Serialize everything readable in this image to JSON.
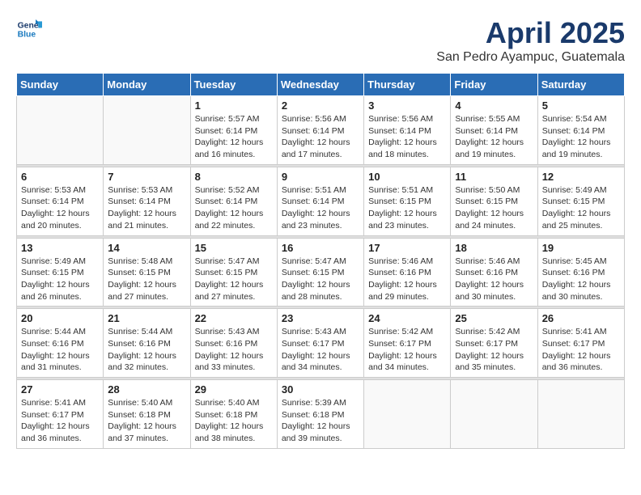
{
  "header": {
    "logo_line1": "General",
    "logo_line2": "Blue",
    "month": "April 2025",
    "location": "San Pedro Ayampuc, Guatemala"
  },
  "days_of_week": [
    "Sunday",
    "Monday",
    "Tuesday",
    "Wednesday",
    "Thursday",
    "Friday",
    "Saturday"
  ],
  "weeks": [
    [
      {
        "day": "",
        "sunrise": "",
        "sunset": "",
        "daylight": ""
      },
      {
        "day": "",
        "sunrise": "",
        "sunset": "",
        "daylight": ""
      },
      {
        "day": "1",
        "sunrise": "Sunrise: 5:57 AM",
        "sunset": "Sunset: 6:14 PM",
        "daylight": "Daylight: 12 hours and 16 minutes."
      },
      {
        "day": "2",
        "sunrise": "Sunrise: 5:56 AM",
        "sunset": "Sunset: 6:14 PM",
        "daylight": "Daylight: 12 hours and 17 minutes."
      },
      {
        "day": "3",
        "sunrise": "Sunrise: 5:56 AM",
        "sunset": "Sunset: 6:14 PM",
        "daylight": "Daylight: 12 hours and 18 minutes."
      },
      {
        "day": "4",
        "sunrise": "Sunrise: 5:55 AM",
        "sunset": "Sunset: 6:14 PM",
        "daylight": "Daylight: 12 hours and 19 minutes."
      },
      {
        "day": "5",
        "sunrise": "Sunrise: 5:54 AM",
        "sunset": "Sunset: 6:14 PM",
        "daylight": "Daylight: 12 hours and 19 minutes."
      }
    ],
    [
      {
        "day": "6",
        "sunrise": "Sunrise: 5:53 AM",
        "sunset": "Sunset: 6:14 PM",
        "daylight": "Daylight: 12 hours and 20 minutes."
      },
      {
        "day": "7",
        "sunrise": "Sunrise: 5:53 AM",
        "sunset": "Sunset: 6:14 PM",
        "daylight": "Daylight: 12 hours and 21 minutes."
      },
      {
        "day": "8",
        "sunrise": "Sunrise: 5:52 AM",
        "sunset": "Sunset: 6:14 PM",
        "daylight": "Daylight: 12 hours and 22 minutes."
      },
      {
        "day": "9",
        "sunrise": "Sunrise: 5:51 AM",
        "sunset": "Sunset: 6:14 PM",
        "daylight": "Daylight: 12 hours and 23 minutes."
      },
      {
        "day": "10",
        "sunrise": "Sunrise: 5:51 AM",
        "sunset": "Sunset: 6:15 PM",
        "daylight": "Daylight: 12 hours and 23 minutes."
      },
      {
        "day": "11",
        "sunrise": "Sunrise: 5:50 AM",
        "sunset": "Sunset: 6:15 PM",
        "daylight": "Daylight: 12 hours and 24 minutes."
      },
      {
        "day": "12",
        "sunrise": "Sunrise: 5:49 AM",
        "sunset": "Sunset: 6:15 PM",
        "daylight": "Daylight: 12 hours and 25 minutes."
      }
    ],
    [
      {
        "day": "13",
        "sunrise": "Sunrise: 5:49 AM",
        "sunset": "Sunset: 6:15 PM",
        "daylight": "Daylight: 12 hours and 26 minutes."
      },
      {
        "day": "14",
        "sunrise": "Sunrise: 5:48 AM",
        "sunset": "Sunset: 6:15 PM",
        "daylight": "Daylight: 12 hours and 27 minutes."
      },
      {
        "day": "15",
        "sunrise": "Sunrise: 5:47 AM",
        "sunset": "Sunset: 6:15 PM",
        "daylight": "Daylight: 12 hours and 27 minutes."
      },
      {
        "day": "16",
        "sunrise": "Sunrise: 5:47 AM",
        "sunset": "Sunset: 6:15 PM",
        "daylight": "Daylight: 12 hours and 28 minutes."
      },
      {
        "day": "17",
        "sunrise": "Sunrise: 5:46 AM",
        "sunset": "Sunset: 6:16 PM",
        "daylight": "Daylight: 12 hours and 29 minutes."
      },
      {
        "day": "18",
        "sunrise": "Sunrise: 5:46 AM",
        "sunset": "Sunset: 6:16 PM",
        "daylight": "Daylight: 12 hours and 30 minutes."
      },
      {
        "day": "19",
        "sunrise": "Sunrise: 5:45 AM",
        "sunset": "Sunset: 6:16 PM",
        "daylight": "Daylight: 12 hours and 30 minutes."
      }
    ],
    [
      {
        "day": "20",
        "sunrise": "Sunrise: 5:44 AM",
        "sunset": "Sunset: 6:16 PM",
        "daylight": "Daylight: 12 hours and 31 minutes."
      },
      {
        "day": "21",
        "sunrise": "Sunrise: 5:44 AM",
        "sunset": "Sunset: 6:16 PM",
        "daylight": "Daylight: 12 hours and 32 minutes."
      },
      {
        "day": "22",
        "sunrise": "Sunrise: 5:43 AM",
        "sunset": "Sunset: 6:16 PM",
        "daylight": "Daylight: 12 hours and 33 minutes."
      },
      {
        "day": "23",
        "sunrise": "Sunrise: 5:43 AM",
        "sunset": "Sunset: 6:17 PM",
        "daylight": "Daylight: 12 hours and 34 minutes."
      },
      {
        "day": "24",
        "sunrise": "Sunrise: 5:42 AM",
        "sunset": "Sunset: 6:17 PM",
        "daylight": "Daylight: 12 hours and 34 minutes."
      },
      {
        "day": "25",
        "sunrise": "Sunrise: 5:42 AM",
        "sunset": "Sunset: 6:17 PM",
        "daylight": "Daylight: 12 hours and 35 minutes."
      },
      {
        "day": "26",
        "sunrise": "Sunrise: 5:41 AM",
        "sunset": "Sunset: 6:17 PM",
        "daylight": "Daylight: 12 hours and 36 minutes."
      }
    ],
    [
      {
        "day": "27",
        "sunrise": "Sunrise: 5:41 AM",
        "sunset": "Sunset: 6:17 PM",
        "daylight": "Daylight: 12 hours and 36 minutes."
      },
      {
        "day": "28",
        "sunrise": "Sunrise: 5:40 AM",
        "sunset": "Sunset: 6:18 PM",
        "daylight": "Daylight: 12 hours and 37 minutes."
      },
      {
        "day": "29",
        "sunrise": "Sunrise: 5:40 AM",
        "sunset": "Sunset: 6:18 PM",
        "daylight": "Daylight: 12 hours and 38 minutes."
      },
      {
        "day": "30",
        "sunrise": "Sunrise: 5:39 AM",
        "sunset": "Sunset: 6:18 PM",
        "daylight": "Daylight: 12 hours and 39 minutes."
      },
      {
        "day": "",
        "sunrise": "",
        "sunset": "",
        "daylight": ""
      },
      {
        "day": "",
        "sunrise": "",
        "sunset": "",
        "daylight": ""
      },
      {
        "day": "",
        "sunrise": "",
        "sunset": "",
        "daylight": ""
      }
    ]
  ]
}
